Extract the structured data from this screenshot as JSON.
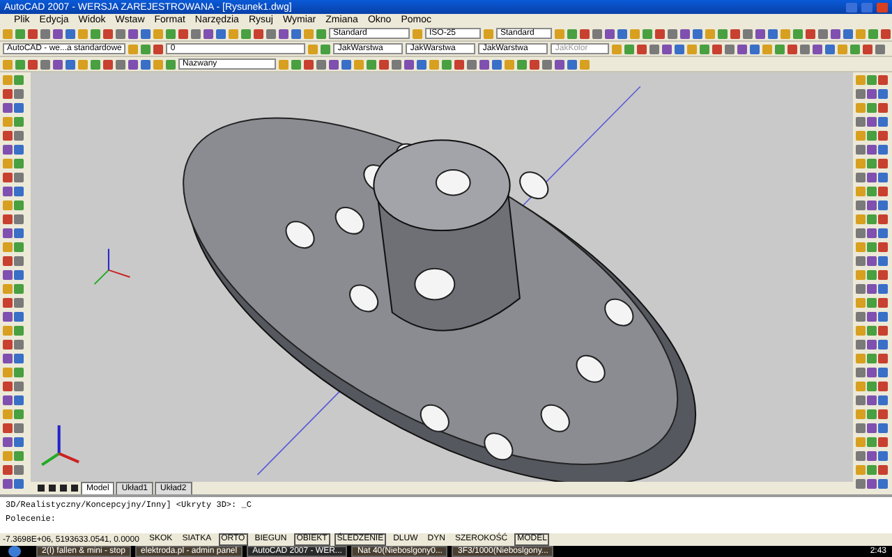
{
  "window": {
    "title": "AutoCAD 2007 - WERSJA ZAREJESTROWANA - [Rysunek1.dwg]"
  },
  "menu": [
    "Plik",
    "Edycja",
    "Widok",
    "Wstaw",
    "Format",
    "Narzędzia",
    "Rysuj",
    "Wymiar",
    "Zmiana",
    "Okno",
    "Pomoc"
  ],
  "toolbar_1": {
    "text_style": "Standard",
    "dim_style": "ISO-25",
    "table_style": "Standard"
  },
  "toolbar_2": {
    "workspace": "AutoCAD - we...a standardowe",
    "layer": "0",
    "properties": [
      "JakWarstwa",
      "JakWarstwa",
      "JakWarstwa"
    ],
    "plot_style": "JakKolor"
  },
  "toolbar_3": {
    "view": "Nazwany"
  },
  "layout_tabs": [
    {
      "label": "Model",
      "selected": true
    },
    {
      "label": "Układ1",
      "selected": false
    },
    {
      "label": "Układ2",
      "selected": false
    }
  ],
  "command_lines": [
    "3D/Realistyczny/Koncepcyjny/Inny] <Ukryty 3D>: _C",
    "Polecenie:"
  ],
  "status_bar": {
    "coordinates": "-7.3698E+06, 5193633.0541, 0.0000",
    "toggles": [
      {
        "label": "SKOK",
        "on": false
      },
      {
        "label": "SIATKA",
        "on": false
      },
      {
        "label": "ORTO",
        "on": true
      },
      {
        "label": "BIEGUN",
        "on": false
      },
      {
        "label": "OBIEKT",
        "on": true
      },
      {
        "label": "ŚLEDZENIE",
        "on": true
      },
      {
        "label": "DLUW",
        "on": false
      },
      {
        "label": "DYN",
        "on": false
      },
      {
        "label": "SZEROKOŚĆ",
        "on": false
      },
      {
        "label": "MODEL",
        "on": true
      }
    ]
  },
  "taskbar": {
    "tasks": [
      {
        "label": "2(I) fallen & mini - stop",
        "selected": false
      },
      {
        "label": "elektroda.pl - admin panel",
        "selected": false
      },
      {
        "label": "AutoCAD 2007 - WER...",
        "selected": true
      },
      {
        "label": "Nat 40(Nieboslgony0...",
        "selected": false
      },
      {
        "label": "3F3/1000(Nieboslgony...",
        "selected": false
      }
    ],
    "clock": "2:43"
  }
}
